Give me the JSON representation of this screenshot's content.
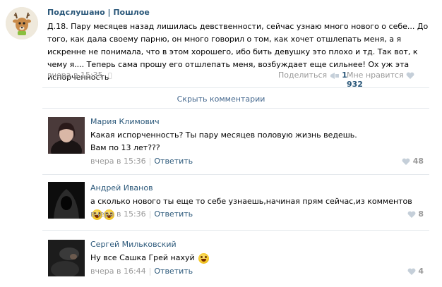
{
  "post": {
    "group_name": "Подслушано | Пошлое",
    "text": "Д.18. Пару месяцев назад лишилась девственности, сейчас узнаю много нового о себе... До того, как дала своему парню, он много говорил о том, как хочет отшлепать меня, а я искренне не понимала, что в этом хорошего, ибо бить девушку это плохо и тд. Так вот, к чему я.... Теперь сама прошу его отшлепать меня, возбуждает еще сильнее! Ох уж эта испорченность",
    "time": "вчера в 15:35",
    "share_label": "Поделиться",
    "share_count": "1",
    "like_label": "Мне нравится",
    "like_count": "932"
  },
  "hide_comments_label": "Скрыть комментарии",
  "comments": [
    {
      "author": "Мария Климович",
      "text_line1": "Какая испорченность? Ты пару месяцев половую жизнь ведешь.",
      "text_line2": "Вам по 13 лет???",
      "time": "вчера в 15:36",
      "reply_label": "Ответить",
      "likes": "48"
    },
    {
      "author": "Андрей Иванов",
      "text_line1": "а сколько нового ты еще то себе узнаешь,начиная прям сейчас,из комментов",
      "time": "вчера в 15:36",
      "reply_label": "Ответить",
      "likes": "8"
    },
    {
      "author": "Сергей Мильковский",
      "text_line1": "Ну все Сашка Грей нахуй",
      "time": "вчера в 16:44",
      "reply_label": "Ответить",
      "likes": "4"
    }
  ],
  "colors": {
    "link": "#2b587a",
    "meta": "#999999",
    "divider": "#e4e8ec"
  }
}
